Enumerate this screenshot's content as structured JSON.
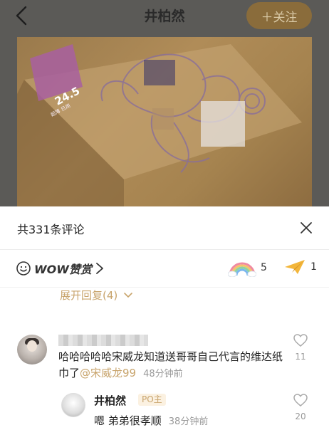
{
  "header": {
    "title": "井柏然",
    "follow_label": "＋关注"
  },
  "photo": {
    "badge_main": "24.5",
    "badge_sub": "超薄 日用"
  },
  "comments_panel": {
    "count_label": "共331条评论"
  },
  "reward": {
    "label": "WOW赞赏",
    "rainbow_count": "5",
    "plane_count": "1"
  },
  "expand": {
    "label": "展开回复(4)"
  },
  "comment": {
    "text_main": "哈哈哈哈哈宋威龙知道送哥哥自己代言的维达纸巾了",
    "mention": "@宋威龙99",
    "time": "48分钟前",
    "likes": "11"
  },
  "reply": {
    "name": "井柏然",
    "badge": "PO主",
    "text": "嗯 弟弟很孝顺",
    "time": "38分钟前",
    "likes": "20"
  },
  "colors": {
    "accent_gold": "#c8a46c",
    "follow_bg": "#8a6c3b",
    "dim_overlay": "#5b5a57"
  }
}
